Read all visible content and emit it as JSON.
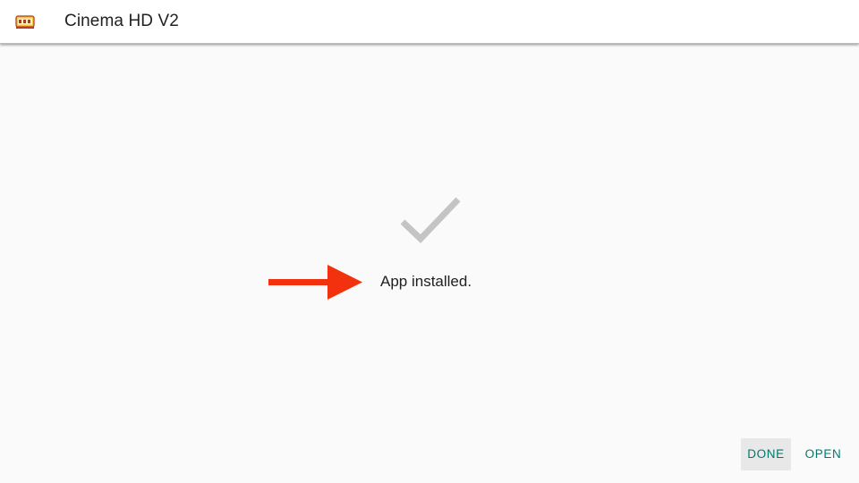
{
  "appbar": {
    "title": "Cinema HD V2",
    "icon": "cinema-hd-app-icon"
  },
  "main": {
    "status_icon": "checkmark-icon",
    "status_text": "App installed.",
    "pointer_icon": "red-arrow-right-icon"
  },
  "actions": {
    "done_label": "DONE",
    "open_label": "OPEN"
  },
  "colors": {
    "background": "#fafafa",
    "appbar": "#ffffff",
    "check": "#c4c4c4",
    "arrow": "#f2310f",
    "button_text": "#00796b",
    "focused_button_bg": "#e8e8e8"
  }
}
